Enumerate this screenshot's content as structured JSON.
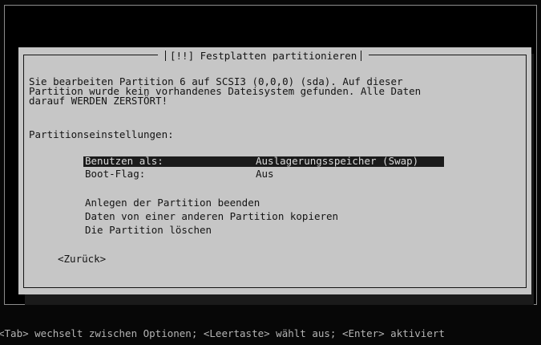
{
  "dialog": {
    "title": "[!!] Festplatten partitionieren",
    "description_lines": [
      "Sie bearbeiten Partition 6 auf SCSI3 (0,0,0) (sda). Auf dieser",
      "Partition wurde kein vorhandenes Dateisystem gefunden. Alle Daten",
      "darauf WERDEN ZERSTÖRT!"
    ],
    "settings_heading": "Partitionseinstellungen:",
    "settings": [
      {
        "label": "Benutzen als:",
        "value": "Auslagerungsspeicher (Swap)",
        "selected": true
      },
      {
        "label": "Boot-Flag:",
        "value": "Aus",
        "selected": false
      }
    ],
    "actions": [
      "Anlegen der Partition beenden",
      "Daten von einer anderen Partition kopieren",
      "Die Partition löschen"
    ],
    "back_button": "<Zurück>"
  },
  "help_line": "<Tab> wechselt zwischen Optionen; <Leertaste> wählt aus; <Enter> aktiviert"
}
